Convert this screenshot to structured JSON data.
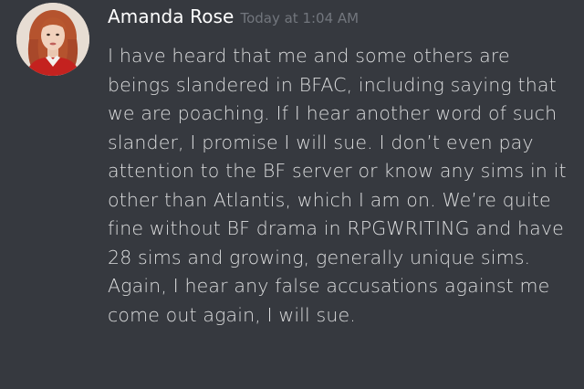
{
  "message": {
    "author": "Amanda Rose",
    "timestamp": "Today at 1:04 AM",
    "avatar_icon": "user-avatar-photo",
    "text": "I have heard that me and some others are beings slandered in BFAC, including saying that we are poaching. If I hear another word of such slander, I promise I will sue. I don’t even pay attention to the BF server or know any sims in it other than Atlantis, which I am on. We’re quite fine without BF drama in RPGWRITING and have 28 sims and growing, generally unique sims. Again, I hear any false accusations against me come out again, I will sue."
  },
  "colors": {
    "background": "#36393f",
    "author": "#ffffff",
    "timestamp": "#72767d",
    "text": "#dcddde"
  }
}
